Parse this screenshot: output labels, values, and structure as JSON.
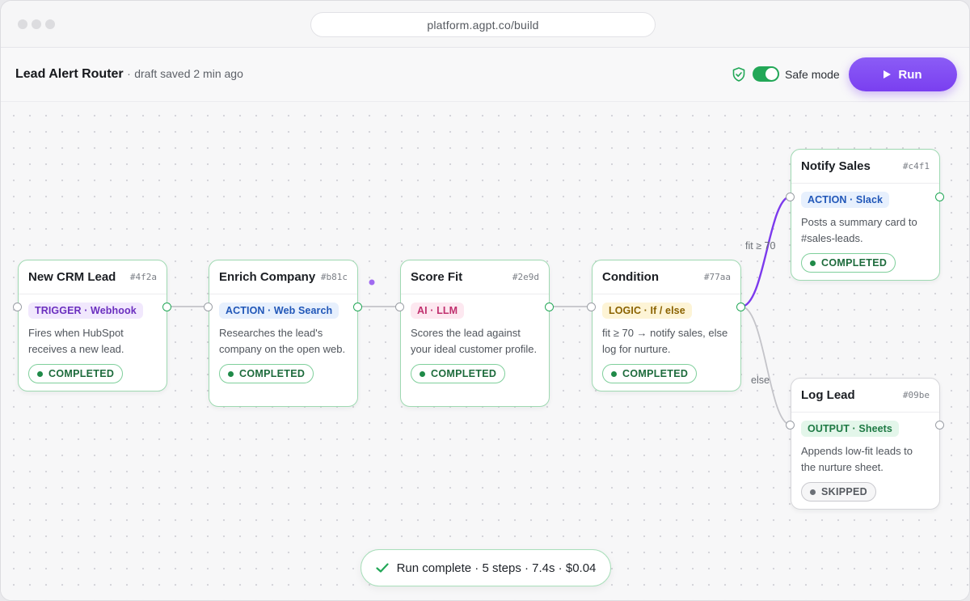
{
  "browser": {
    "url": "platform.agpt.co/build"
  },
  "header": {
    "title": "Lead Alert Router",
    "separator": "·",
    "saved_status": "draft saved 2 min ago",
    "safe_mode_label": "Safe mode",
    "safe_mode_on": true,
    "run_label": "Run"
  },
  "nodes": [
    {
      "name": "New CRM Lead",
      "id": "#4f2a",
      "tag": "TRIGGER · Webhook",
      "desc": "Fires when HubSpot receives a new lead.",
      "status": "COMPLETED"
    },
    {
      "name": "Enrich Company",
      "id": "#b81c",
      "tag": "ACTION · Web Search",
      "desc": "Researches the lead's company on the open web.",
      "status": "COMPLETED"
    },
    {
      "name": "Score Fit",
      "id": "#2e9d",
      "tag": "AI · LLM",
      "desc": "Scores the lead against your ideal customer profile.",
      "status": "COMPLETED"
    },
    {
      "name": "Condition",
      "id": "#77aa",
      "tag": "LOGIC · If / else",
      "desc": "fit ≥ 70 → notify sales, else log for nurture.",
      "status": "COMPLETED"
    },
    {
      "name": "Notify Sales",
      "id": "#c4f1",
      "tag": "ACTION · Slack",
      "desc": "Posts a summary card to #sales-leads.",
      "status": "COMPLETED"
    },
    {
      "name": "Log Lead",
      "id": "#09be",
      "tag": "OUTPUT · Sheets",
      "desc": "Appends low-fit leads to the nurture sheet.",
      "status": "SKIPPED"
    }
  ],
  "edges": {
    "true_label": "fit ≥ 70",
    "false_label": "else"
  },
  "toast": {
    "text": "Run complete · 5 steps · 7.4s · $0.04"
  },
  "colors": {
    "accent": "#7c3aed",
    "success": "#22a757",
    "skipped": "#6c7077"
  }
}
